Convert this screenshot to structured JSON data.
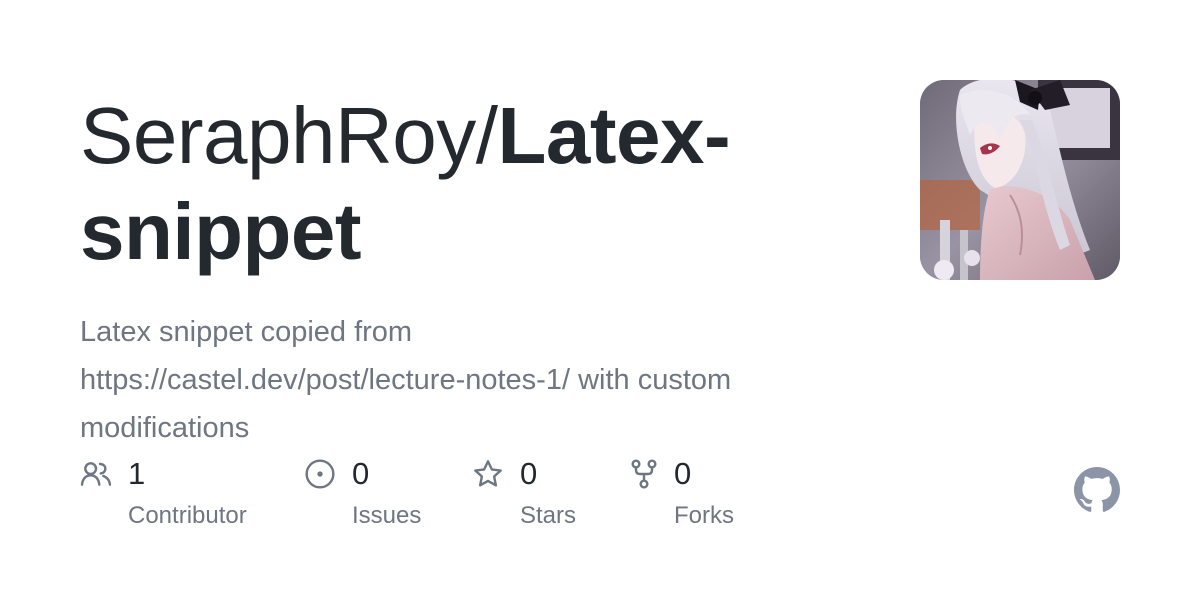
{
  "repo": {
    "owner": "SeraphRoy/",
    "name": "Latex-snippet",
    "description": "Latex snippet copied from https://castel.dev/post/lecture-notes-1/ with custom modifications"
  },
  "avatar": {
    "alt": "owner avatar"
  },
  "stats": [
    {
      "count": "1",
      "label": "Contributor",
      "icon": "people-icon"
    },
    {
      "count": "0",
      "label": "Issues",
      "icon": "issue-opened-icon"
    },
    {
      "count": "0",
      "label": "Stars",
      "icon": "star-icon"
    },
    {
      "count": "0",
      "label": "Forks",
      "icon": "repo-forked-icon"
    }
  ],
  "colors": {
    "text_primary": "#24292f",
    "text_secondary": "#6e7681",
    "icon": "#6e7681",
    "github_logo": "#8b95a7",
    "background": "#ffffff"
  },
  "logo": {
    "icon": "github-mark-icon"
  }
}
